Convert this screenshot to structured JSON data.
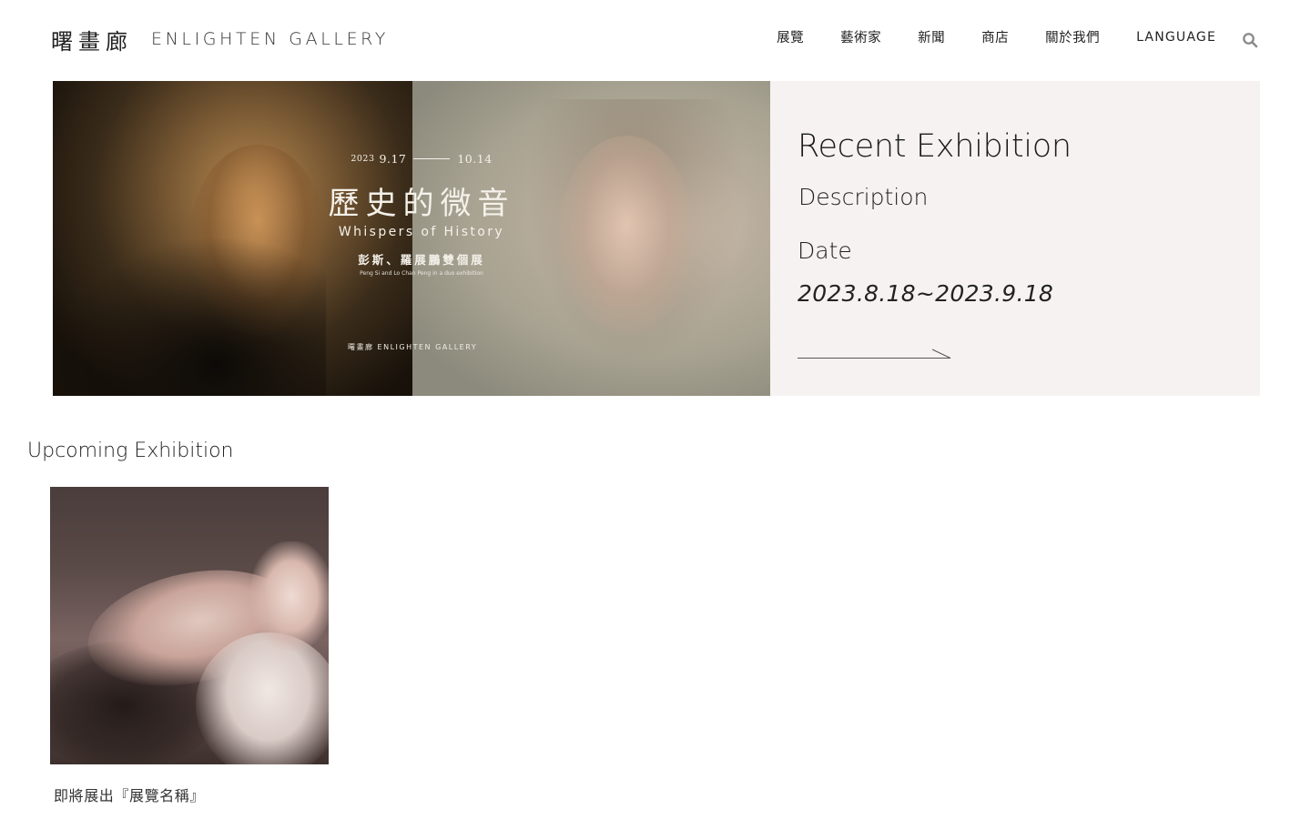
{
  "header": {
    "logo_cn": "曙畫廊",
    "logo_en": "ENLIGHTEN GALLERY",
    "nav": [
      "展覽",
      "藝術家",
      "新聞",
      "商店",
      "關於我們"
    ],
    "language_label": "LANGUAGE",
    "search_icon": "search-icon"
  },
  "hero": {
    "poster": {
      "year": "2023",
      "start": "9.17",
      "end": "10.14",
      "title_cn": "歷史的微音",
      "title_en": "Whispers of History",
      "artists_cn": "彭斯、羅展鵬雙個展",
      "artists_en": "Peng Si and Lo Chan Peng in a duo exhibition",
      "gallery_mark": "曙畫廊  ENLIGHTEN GALLERY"
    },
    "info": {
      "title": "Recent Exhibition",
      "description": "Description",
      "date_label": "Date",
      "date_value": "2023.8.18~2023.9.18",
      "arrow_icon": "arrow-right-icon"
    }
  },
  "upcoming": {
    "heading": "Upcoming Exhibition",
    "items": [
      {
        "caption": "即將展出『展覽名稱』"
      }
    ]
  },
  "colors": {
    "info_panel_bg": "#f7f2f2",
    "text": "#1a1a1a"
  }
}
